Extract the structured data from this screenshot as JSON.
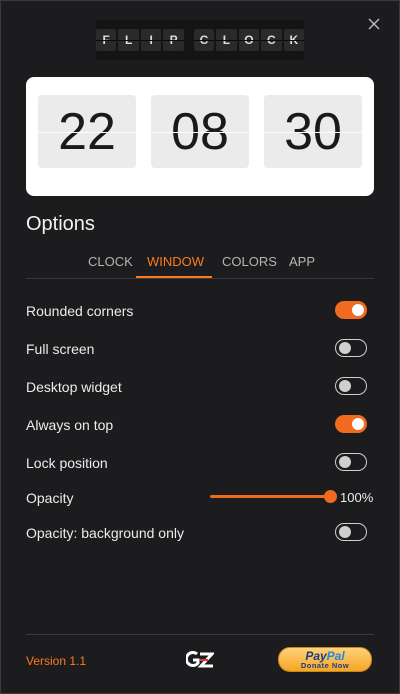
{
  "logo": {
    "letters": [
      "F",
      "L",
      "I",
      "P",
      "C",
      "L",
      "O",
      "C",
      "K"
    ]
  },
  "clock": {
    "hours": "22",
    "minutes": "08",
    "seconds": "30"
  },
  "options": {
    "title": "Options",
    "tabs": [
      {
        "label": "CLOCK",
        "active": false
      },
      {
        "label": "WINDOW",
        "active": true
      },
      {
        "label": "COLORS",
        "active": false
      },
      {
        "label": "APP",
        "active": false
      }
    ]
  },
  "settings": [
    {
      "label": "Rounded corners",
      "on": true
    },
    {
      "label": "Full screen",
      "on": false
    },
    {
      "label": "Desktop widget",
      "on": false
    },
    {
      "label": "Always on top",
      "on": true
    },
    {
      "label": "Lock position",
      "on": false
    }
  ],
  "opacity": {
    "label": "Opacity",
    "value_text": "100%",
    "value": 1.0
  },
  "opacity_bg": {
    "label": "Opacity: background only",
    "on": false
  },
  "footer": {
    "version": "Version 1.1",
    "gz_logo_text": "GZ",
    "paypal_brand_1": "Pay",
    "paypal_brand_2": "Pal",
    "paypal_sub": "Donate Now"
  },
  "colors": {
    "accent": "#f06a1f",
    "background": "#1c1b1d",
    "card": "#ffffff"
  }
}
